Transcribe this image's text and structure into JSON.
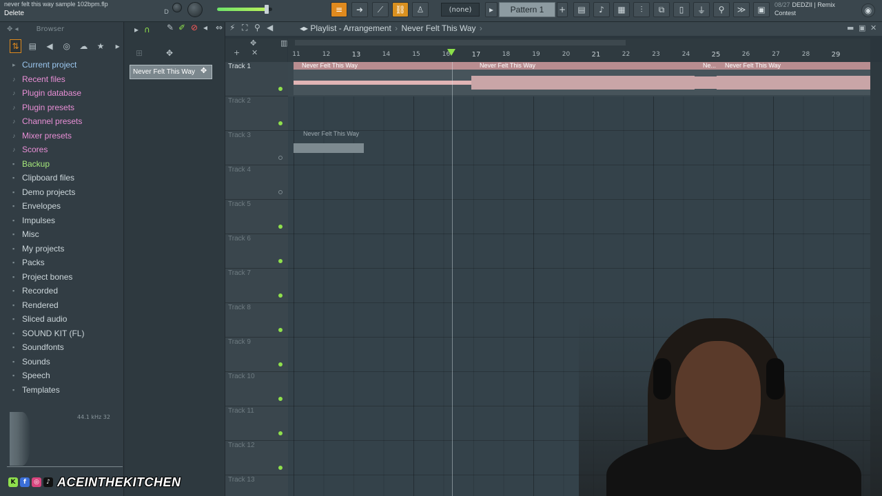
{
  "topbar": {
    "file_title": "never felt this way sample 102bpm.flp",
    "hint": "Delete",
    "d_label": "D",
    "volume": 0.9,
    "pattern_none": "(none)",
    "pattern_label": "Pattern 1",
    "hint_date": "08/27",
    "hint_line1": "DEDZII | Remix",
    "hint_line2": "Contest"
  },
  "browser": {
    "header": "Browser",
    "items": [
      {
        "label": "Current project",
        "style": "blue"
      },
      {
        "label": "Recent files",
        "style": "pink"
      },
      {
        "label": "Plugin database",
        "style": "pink"
      },
      {
        "label": "Plugin presets",
        "style": "pink"
      },
      {
        "label": "Channel presets",
        "style": "pink"
      },
      {
        "label": "Mixer presets",
        "style": "pink"
      },
      {
        "label": "Scores",
        "style": "pink"
      },
      {
        "label": "Backup",
        "style": "green"
      },
      {
        "label": "Clipboard files",
        "style": ""
      },
      {
        "label": "Demo projects",
        "style": ""
      },
      {
        "label": "Envelopes",
        "style": ""
      },
      {
        "label": "Impulses",
        "style": ""
      },
      {
        "label": "Misc",
        "style": ""
      },
      {
        "label": "My projects",
        "style": ""
      },
      {
        "label": "Packs",
        "style": ""
      },
      {
        "label": "Project bones",
        "style": ""
      },
      {
        "label": "Recorded",
        "style": ""
      },
      {
        "label": "Rendered",
        "style": ""
      },
      {
        "label": "Sliced audio",
        "style": ""
      },
      {
        "label": "SOUND KIT (FL)",
        "style": ""
      },
      {
        "label": "Soundfonts",
        "style": ""
      },
      {
        "label": "Sounds",
        "style": ""
      },
      {
        "label": "Speech",
        "style": ""
      },
      {
        "label": "Templates",
        "style": ""
      }
    ],
    "preview_info": "44.1 kHz 32"
  },
  "picker": {
    "item": "Never Felt This Way"
  },
  "playlist": {
    "title_prefix": "Playlist - Arrangement",
    "title_name": "Never Felt This Way",
    "sep": "›",
    "ruler": [
      "11",
      "12",
      "13",
      "14",
      "15",
      "16",
      "17",
      "18",
      "19",
      "20",
      "21",
      "22",
      "23",
      "24",
      "25",
      "26",
      "27",
      "28",
      "29"
    ],
    "tracks": [
      "Track 1",
      "Track 2",
      "Track 3",
      "Track 4",
      "Track 5",
      "Track 6",
      "Track 7",
      "Track 8",
      "Track 9",
      "Track 10",
      "Track 11",
      "Track 12",
      "Track 13"
    ],
    "clips": [
      {
        "name": "Never Felt This Way"
      },
      {
        "name": "Never Felt This Way"
      },
      {
        "name": "Ne..."
      },
      {
        "name": "Never Felt This Way"
      },
      {
        "name": "Never Felt This Way"
      }
    ]
  },
  "brand": {
    "text": "ACEINTHEKITCHEN"
  }
}
